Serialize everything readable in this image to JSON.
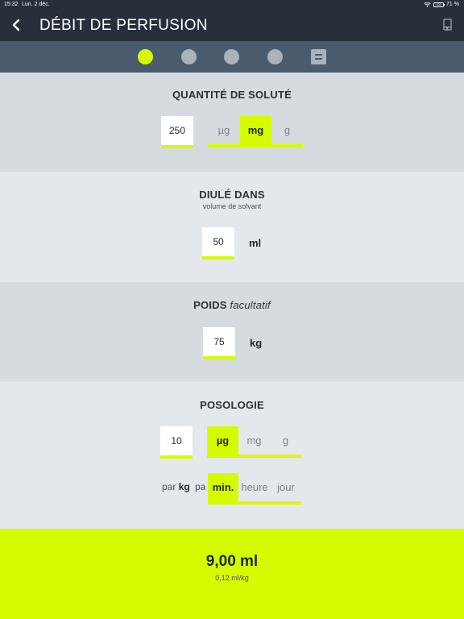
{
  "status_bar": {
    "time": "15:32",
    "date": "Lun. 2 déc.",
    "battery_label": "71 %",
    "battery_badge": "100"
  },
  "header": {
    "title": "DÉBIT DE PERFUSION",
    "back_icon": "chevron-left-icon",
    "book_icon": "book-icon"
  },
  "stepper": {
    "steps": 5,
    "active_index": 0,
    "last_step_icon": "summary-icon"
  },
  "colors": {
    "accent": "#d6fb00",
    "header_bg": "#27303a",
    "stepper_bg": "#4b5b6e"
  },
  "solute": {
    "heading": "QUANTITÉ DE SOLUTÉ",
    "value": "250",
    "units": [
      "µg",
      "mg",
      "g"
    ],
    "selected_unit": "mg"
  },
  "diluent": {
    "heading": "DIULÉ DANS",
    "subheading": "volume de solvant",
    "value": "50",
    "unit": "ml"
  },
  "weight": {
    "heading": "POIDS",
    "heading_note": "facultatif",
    "value": "75",
    "unit": "kg"
  },
  "dosage": {
    "heading": "POSOLOGIE",
    "value": "10",
    "units": [
      "µg",
      "mg",
      "g"
    ],
    "selected_unit": "µg",
    "per_label": "par",
    "per_unit": "kg",
    "per_label_2": "pa",
    "time_units": [
      "min.",
      "heure",
      "jour"
    ],
    "selected_time_unit": "min."
  },
  "result": {
    "main": "9,00 ml",
    "sub": "0,12 ml/kg"
  }
}
